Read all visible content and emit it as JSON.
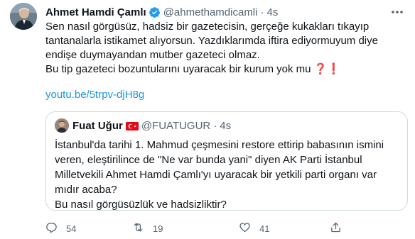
{
  "tweet": {
    "author_name": "Ahmet Hamdi Çamlı",
    "author_handle": "@ahmethamdicamli",
    "separator": "·",
    "time": "4s",
    "lines": [
      "Sen nasıl görgüsüz, hadsiz bir gazetecisin, gerçeğe kukakları tıkayıp",
      "tantanalarla istikamet alıyorsun. Yazdıklarımda iftira ediyormuyum diye",
      "endişe duymayandan mutber gazeteci olmaz.",
      "Bu tip gazeteci bozuntularını uyaracak bir kurum yok mu"
    ],
    "emojis": "❓❗",
    "link": "youtu.be/5trpv-djH8g"
  },
  "quote": {
    "author_name": "Fuat Uğur",
    "author_handle": "@FUATUGUR",
    "separator": "·",
    "time": "4s",
    "lines": [
      "İstanbul'da tarihi 1. Mahmud çeşmesini restore ettirip babasının ismini",
      "veren, eleştirilince de \"Ne var bunda yani\" diyen AK Parti İstanbul",
      "Milletvekili Ahmet Hamdi Çamlı'yı uyaracak bir yetkili parti organı var",
      "mıdır acaba?",
      "Bu nasıl görgüsüzlük ve hadsizliktir?"
    ]
  },
  "actions": {
    "reply_count": "54",
    "retweet_count": "19",
    "like_count": "41"
  },
  "colors": {
    "accent": "#1b95e0",
    "secondary_text": "#536471",
    "border": "#cfd9de",
    "emoji_red": "#e0245e"
  },
  "icons": [
    "verified-badge-icon",
    "more-icon",
    "turkey-flag-icon",
    "reply-icon",
    "retweet-icon",
    "like-icon",
    "share-icon"
  ]
}
